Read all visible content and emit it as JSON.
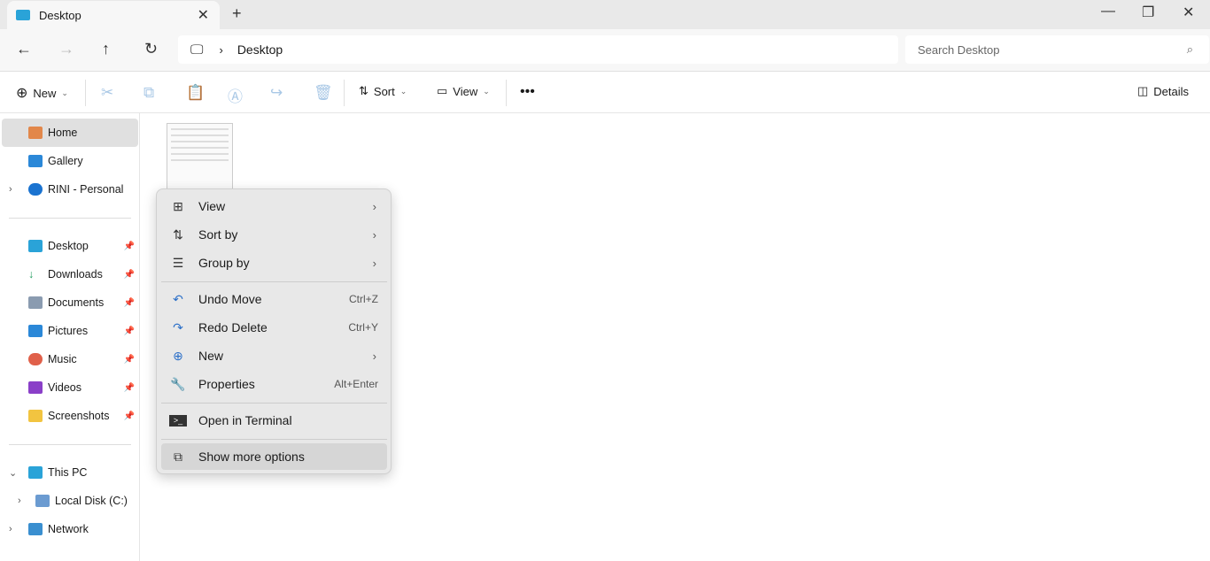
{
  "window": {
    "tab_title": "Desktop"
  },
  "nav": {
    "breadcrumb": "Desktop",
    "search_placeholder": "Search Desktop"
  },
  "toolbar": {
    "new": "New",
    "sort": "Sort",
    "view": "View",
    "details": "Details"
  },
  "sidebar": {
    "home": "Home",
    "gallery": "Gallery",
    "onedrive": "RINI - Personal",
    "desktop": "Desktop",
    "downloads": "Downloads",
    "documents": "Documents",
    "pictures": "Pictures",
    "music": "Music",
    "videos": "Videos",
    "screenshots": "Screenshots",
    "thispc": "This PC",
    "localdisk": "Local Disk (C:)",
    "network": "Network"
  },
  "menu": {
    "view": "View",
    "sortby": "Sort by",
    "groupby": "Group by",
    "undo": "Undo Move",
    "undo_sc": "Ctrl+Z",
    "redo": "Redo Delete",
    "redo_sc": "Ctrl+Y",
    "new": "New",
    "properties": "Properties",
    "properties_sc": "Alt+Enter",
    "terminal": "Open in Terminal",
    "more": "Show more options"
  }
}
